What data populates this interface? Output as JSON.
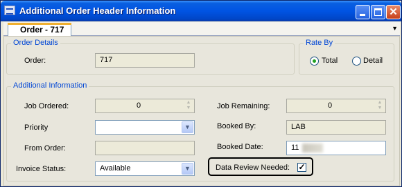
{
  "window": {
    "title": "Additional Order Header Information"
  },
  "tab": {
    "label": "Order - 717"
  },
  "order_details": {
    "group_title": "Order Details",
    "order_label": "Order:",
    "order_value": "717"
  },
  "rate_by": {
    "group_title": "Rate By",
    "options": [
      {
        "label": "Total",
        "selected": true
      },
      {
        "label": "Detail",
        "selected": false
      }
    ]
  },
  "additional_info": {
    "group_title": "Additional Information",
    "job_ordered": {
      "label": "Job Ordered:",
      "value": "0"
    },
    "job_remaining": {
      "label": "Job Remaining:",
      "value": "0"
    },
    "priority": {
      "label": "Priority",
      "value": ""
    },
    "booked_by": {
      "label": "Booked By:",
      "value": "LAB"
    },
    "from_order": {
      "label": "From Order:",
      "value": ""
    },
    "booked_date": {
      "label": "Booked Date:",
      "value": "11"
    },
    "invoice_status": {
      "label": "Invoice Status:",
      "value": "Available"
    },
    "data_review_needed": {
      "label": "Data Review Needed:",
      "checked": true
    }
  },
  "colors": {
    "titlebar": "#0054e3",
    "group_title": "#0046d5",
    "tab_accent": "#f0b030"
  }
}
